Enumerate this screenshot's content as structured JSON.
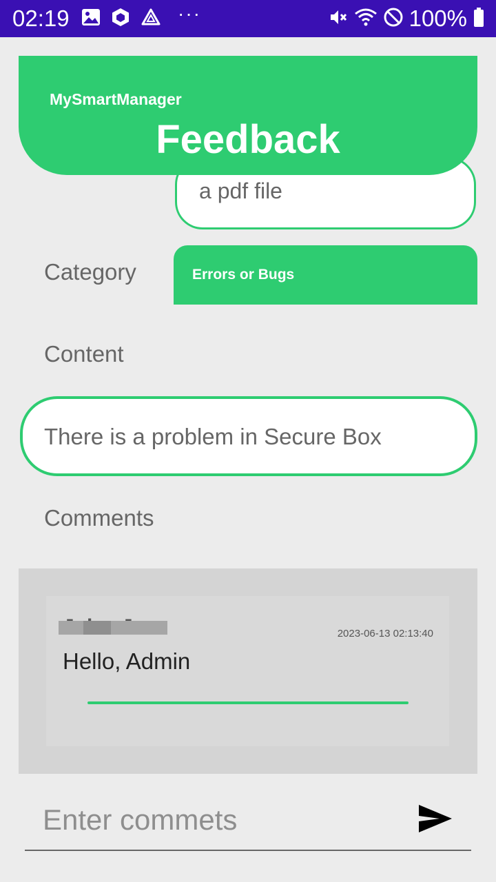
{
  "status_bar": {
    "time": "02:19",
    "battery": "100%",
    "more": "···",
    "icons": [
      "image-icon",
      "cube-icon",
      "triangle-icon",
      "mute-icon",
      "wifi-icon",
      "do-not-disturb-icon",
      "battery-icon"
    ]
  },
  "header": {
    "app_name": "MySmartManager",
    "title": "Feedback"
  },
  "form": {
    "file_field_text": "a pdf file",
    "category_label": "Category",
    "category_value": "Errors or Bugs",
    "content_label": "Content",
    "content_value": "There is a problem in Secure Box",
    "comments_label": "Comments"
  },
  "comments": [
    {
      "author": "Julee Jo",
      "time": "2023-06-13 02:13:40",
      "text": "Hello, Admin"
    }
  ],
  "comment_input": {
    "placeholder": "Enter commets",
    "send_icon": "send-icon"
  },
  "colors": {
    "accent": "#2ecc71",
    "status_bar": "#3a10b3",
    "background": "#ececec"
  }
}
